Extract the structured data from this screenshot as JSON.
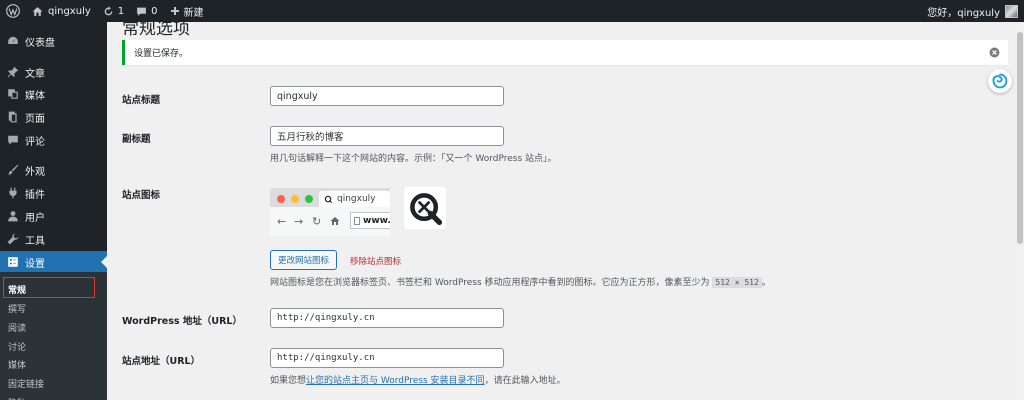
{
  "adminbar": {
    "site_name": "qingxuly",
    "updates_count": "1",
    "comments_count": "0",
    "new_label": "新建",
    "greeting": "您好，qingxuly"
  },
  "sidebar": {
    "items": [
      {
        "label": "仪表盘",
        "icon": "dashboard-icon"
      },
      {
        "label": "文章",
        "icon": "pin-icon"
      },
      {
        "label": "媒体",
        "icon": "media-icon"
      },
      {
        "label": "页面",
        "icon": "page-icon"
      },
      {
        "label": "评论",
        "icon": "comment-icon"
      },
      {
        "label": "外观",
        "icon": "brush-icon"
      },
      {
        "label": "插件",
        "icon": "plugin-icon"
      },
      {
        "label": "用户",
        "icon": "user-icon"
      },
      {
        "label": "工具",
        "icon": "wrench-icon"
      },
      {
        "label": "设置",
        "icon": "settings-icon"
      }
    ],
    "submenu": [
      "常规",
      "撰写",
      "阅读",
      "讨论",
      "媒体",
      "固定链接",
      "隐私"
    ]
  },
  "page": {
    "title": "常规选项",
    "notice": "设置已保存。"
  },
  "form": {
    "site_title_label": "站点标题",
    "site_title_value": "qingxuly",
    "tagline_label": "副标题",
    "tagline_value": "五月行秋的博客",
    "tagline_desc": "用几句话解释一下这个网站的内容。示例：「又一个 WordPress 站点」。",
    "site_icon_label": "站点图标",
    "browser_tab_text": "qingxuly",
    "browser_url_text": "www.",
    "change_icon_button": "更改网站图标",
    "remove_icon_link": "移除站点图标",
    "site_icon_desc": "网站图标是您在浏览器标签页、书签栏和 WordPress 移动应用程序中看到的图标。它应为正方形，像素至少为",
    "site_icon_size": "512 × 512",
    "site_icon_desc_end": "。",
    "wp_address_label": "WordPress 地址（URL）",
    "wp_address_value": "http://qingxuly.cn",
    "site_address_label": "站点地址（URL）",
    "site_address_value": "http://qingxuly.cn",
    "site_address_desc_pre": "如果您想",
    "site_address_desc_link": "让您的站点主页与 WordPress 安装目录不同",
    "site_address_desc_post": "，请在此输入地址。"
  },
  "colors": {
    "admin_dark": "#1d2327",
    "accent": "#2271b1",
    "success": "#00a32a",
    "danger": "#d63638"
  }
}
